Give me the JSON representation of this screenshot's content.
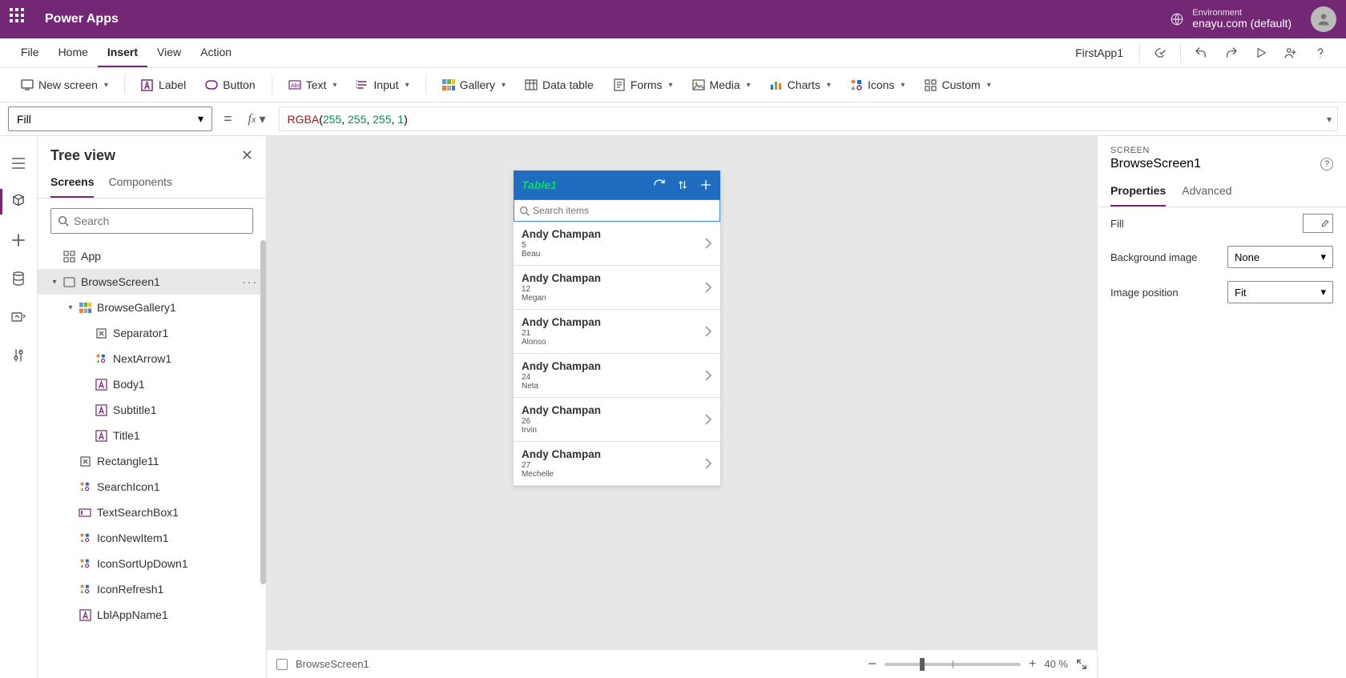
{
  "header": {
    "app_name": "Power Apps",
    "environment_label": "Environment",
    "environment_value": "enayu.com (default)"
  },
  "menubar": {
    "items": [
      "File",
      "Home",
      "Insert",
      "View",
      "Action"
    ],
    "active_index": 2,
    "app_title": "FirstApp1"
  },
  "ribbon": {
    "new_screen": "New screen",
    "label": "Label",
    "button": "Button",
    "text": "Text",
    "input": "Input",
    "gallery": "Gallery",
    "data_table": "Data table",
    "forms": "Forms",
    "media": "Media",
    "charts": "Charts",
    "icons": "Icons",
    "custom": "Custom"
  },
  "formula": {
    "property": "Fill",
    "fn": "RGBA",
    "args": [
      "255",
      "255",
      "255",
      "1"
    ]
  },
  "treeview": {
    "title": "Tree view",
    "tabs": [
      "Screens",
      "Components"
    ],
    "active_tab": 0,
    "search_placeholder": "Search",
    "items": [
      {
        "label": "App",
        "indent": 0,
        "icon": "app",
        "expand": null
      },
      {
        "label": "BrowseScreen1",
        "indent": 0,
        "icon": "screen",
        "expand": "open",
        "selected": true,
        "dots": true
      },
      {
        "label": "BrowseGallery1",
        "indent": 1,
        "icon": "gallery",
        "expand": "open"
      },
      {
        "label": "Separator1",
        "indent": 2,
        "icon": "sep"
      },
      {
        "label": "NextArrow1",
        "indent": 2,
        "icon": "iconctl"
      },
      {
        "label": "Body1",
        "indent": 2,
        "icon": "labelctl"
      },
      {
        "label": "Subtitle1",
        "indent": 2,
        "icon": "labelctl"
      },
      {
        "label": "Title1",
        "indent": 2,
        "icon": "labelctl"
      },
      {
        "label": "Rectangle11",
        "indent": 1,
        "icon": "sep"
      },
      {
        "label": "SearchIcon1",
        "indent": 1,
        "icon": "iconctl"
      },
      {
        "label": "TextSearchBox1",
        "indent": 1,
        "icon": "textinput"
      },
      {
        "label": "IconNewItem1",
        "indent": 1,
        "icon": "iconctl"
      },
      {
        "label": "IconSortUpDown1",
        "indent": 1,
        "icon": "iconctl"
      },
      {
        "label": "IconRefresh1",
        "indent": 1,
        "icon": "iconctl"
      },
      {
        "label": "LblAppName1",
        "indent": 1,
        "icon": "labelctl"
      }
    ]
  },
  "canvas": {
    "screen_title": "Table1",
    "search_placeholder": "Search items",
    "list": [
      {
        "title": "Andy Champan",
        "sub1": "5",
        "sub2": "Beau"
      },
      {
        "title": "Andy Champan",
        "sub1": "12",
        "sub2": "Megan"
      },
      {
        "title": "Andy Champan",
        "sub1": "21",
        "sub2": "Alonso"
      },
      {
        "title": "Andy Champan",
        "sub1": "24",
        "sub2": "Neta"
      },
      {
        "title": "Andy Champan",
        "sub1": "26",
        "sub2": "Irvin"
      },
      {
        "title": "Andy Champan",
        "sub1": "27",
        "sub2": "Mechelle"
      }
    ],
    "footer_screen": "BrowseScreen1",
    "zoom_label": "40  %"
  },
  "properties": {
    "kind": "SCREEN",
    "name": "BrowseScreen1",
    "tabs": [
      "Properties",
      "Advanced"
    ],
    "active_tab": 0,
    "rows": {
      "fill": "Fill",
      "background_image": "Background image",
      "background_image_value": "None",
      "image_position": "Image position",
      "image_position_value": "Fit"
    }
  }
}
